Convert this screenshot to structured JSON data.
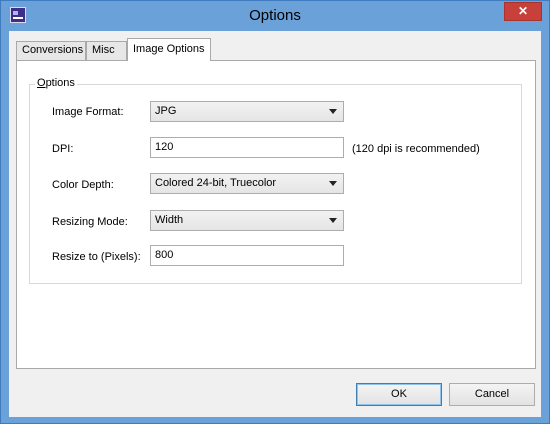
{
  "window": {
    "title": "Options"
  },
  "titlebar": {
    "close_glyph": "✕"
  },
  "tabs": [
    {
      "label": "Conversions",
      "active": false
    },
    {
      "label": "Misc",
      "active": false
    },
    {
      "label": "Image Options",
      "active": true
    }
  ],
  "group": {
    "label_first": "O",
    "label_rest": "ptions"
  },
  "fields": {
    "image_format": {
      "label": "Image Format:",
      "value": "JPG"
    },
    "dpi": {
      "label": "DPI:",
      "value": "120",
      "hint": "(120 dpi is recommended)"
    },
    "color_depth": {
      "label": "Color Depth:",
      "value": "Colored 24-bit, Truecolor"
    },
    "resizing_mode": {
      "label": "Resizing Mode:",
      "value": "Width"
    },
    "resize_to": {
      "label": "Resize to (Pixels):",
      "value": "800"
    }
  },
  "buttons": {
    "ok": "OK",
    "cancel": "Cancel"
  },
  "colors": {
    "titlebar": "#6ba1d9",
    "close": "#c7403a",
    "dialog_bg": "#f0f0f0"
  },
  "icons": {
    "app": "app-icon",
    "close": "close-icon",
    "dropdown": "chevron-down-icon"
  }
}
